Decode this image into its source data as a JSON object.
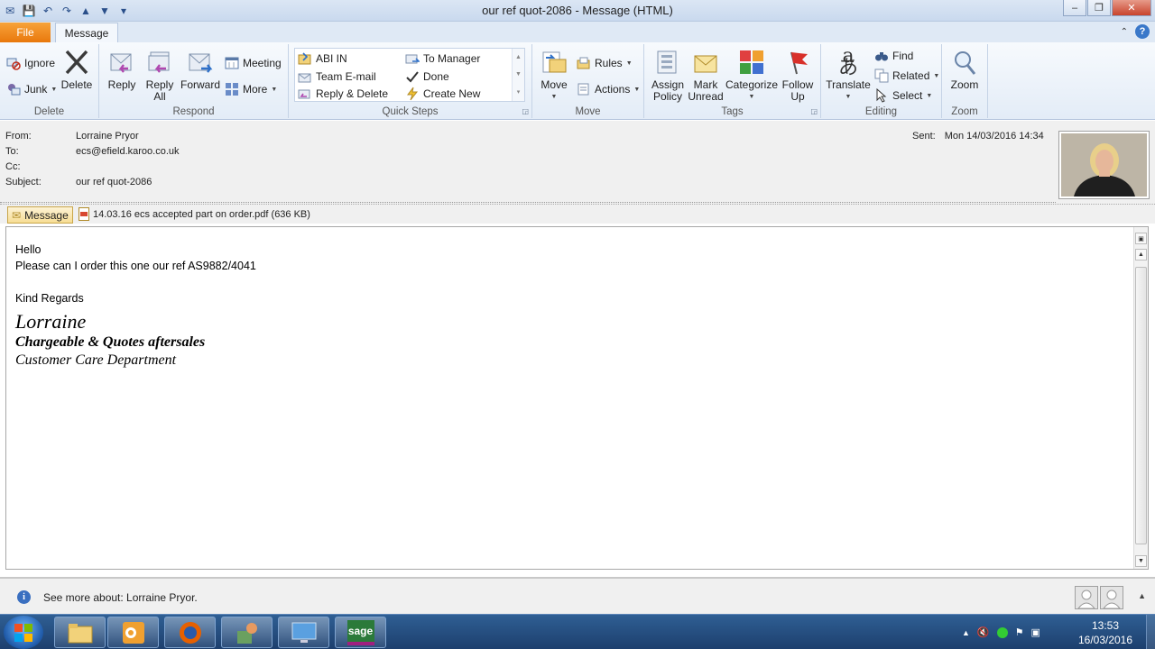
{
  "window": {
    "title": "our ref quot-2086  -  Message (HTML)",
    "min": "–",
    "max": "❐",
    "close": "✕"
  },
  "tabs": {
    "file": "File",
    "message": "Message"
  },
  "ribbon": {
    "delete_group": {
      "label": "Delete",
      "ignore": "Ignore",
      "junk": "Junk",
      "delete": "Delete"
    },
    "respond_group": {
      "label": "Respond",
      "reply": "Reply",
      "reply_all_1": "Reply",
      "reply_all_2": "All",
      "forward": "Forward",
      "meeting": "Meeting",
      "more": "More"
    },
    "quicksteps_group": {
      "label": "Quick Steps",
      "items": [
        "ABI IN",
        "To Manager",
        "Team E-mail",
        "Done",
        "Reply & Delete",
        "Create New"
      ]
    },
    "move_group": {
      "label": "Move",
      "move": "Move",
      "rules": "Rules",
      "actions": "Actions"
    },
    "tags_group": {
      "label": "Tags",
      "assign_1": "Assign",
      "assign_2": "Policy",
      "mark_1": "Mark",
      "mark_2": "Unread",
      "categorize": "Categorize",
      "follow_1": "Follow",
      "follow_2": "Up"
    },
    "editing_group": {
      "label": "Editing",
      "translate": "Translate",
      "find": "Find",
      "related": "Related",
      "select": "Select"
    },
    "zoom_group": {
      "label": "Zoom",
      "zoom": "Zoom"
    }
  },
  "header": {
    "from_label": "From:",
    "from": "Lorraine Pryor",
    "to_label": "To:",
    "to": "ecs@efield.karoo.co.uk",
    "cc_label": "Cc:",
    "cc": "",
    "subject_label": "Subject:",
    "subject": "our ref quot-2086",
    "sent_label": "Sent:",
    "sent": "Mon 14/03/2016 14:34"
  },
  "attachments": {
    "message_tab": "Message",
    "file": "14.03.16 ecs accepted part on order.pdf (636 KB)"
  },
  "body": {
    "line1": "Hello",
    "line2": "Please can I order this one  our ref AS9882/4041",
    "line3": "Kind Regards",
    "sig_name": "Lorraine",
    "sig_title": "Chargeable & Quotes aftersales",
    "sig_dept": "Customer Care Department"
  },
  "people_pane": {
    "text": "See more about: Lorraine Pryor."
  },
  "taskbar": {
    "time": "13:53",
    "date": "16/03/2016",
    "sage_label": "sage"
  },
  "colors": {
    "file_tab": "#e9780c",
    "title_bg": "#dbe6f4",
    "taskbar": "#2f5f94"
  }
}
